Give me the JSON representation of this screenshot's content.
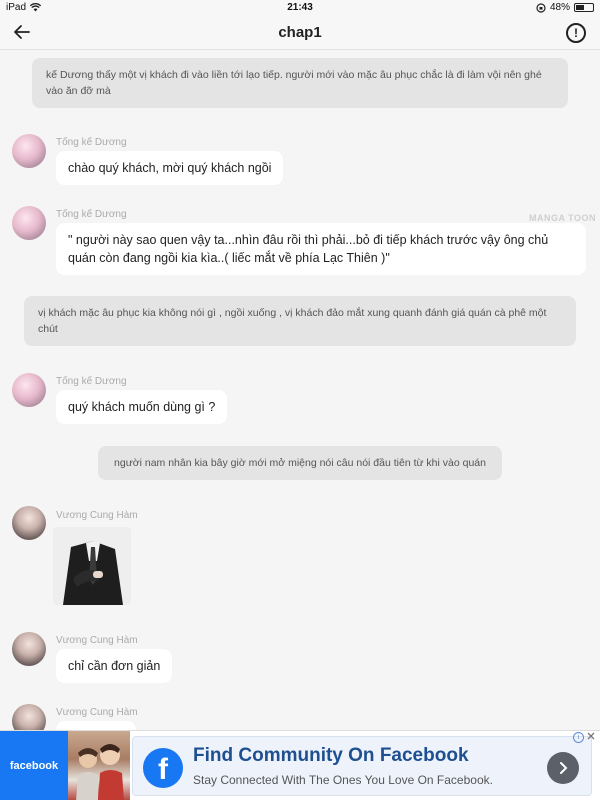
{
  "status_bar": {
    "device": "iPad",
    "wifi_icon": "wifi-icon",
    "time": "21:43",
    "battery_text": "48%",
    "battery_level": 0.48
  },
  "nav": {
    "back_icon": "arrow-left-icon",
    "title": "chap1",
    "info_icon": "info-circle-icon"
  },
  "messages": [
    {
      "type": "narration",
      "text": "kế Dương thấy một vị khách đi vào liền tới lạo tiếp. người mới vào mặc âu phục  chắc là đi làm vội nên ghé vào ăn đỡ mà"
    },
    {
      "type": "message",
      "sender": "Tống kế Dương",
      "text": "chào quý khách, mời quý khách ngồi"
    },
    {
      "type": "message",
      "sender": "Tống kế Dương",
      "text": "\" người này sao quen vậy ta...nhìn đâu rồi thì phải...bỏ đi tiếp khách trước vậy ông chủ quán còn đang ngồi kia kìa..( liếc mắt về phía Lạc Thiên  )\""
    },
    {
      "type": "narration",
      "text": "vị khách mặc âu phục kia không nói gì , ngồi xuống , vị khách đảo mắt xung quanh đánh giá quán cà phê một chút"
    },
    {
      "type": "message",
      "sender": "Tống kế Dương",
      "text": "quý khách muốn dùng gì ?"
    },
    {
      "type": "narration",
      "text": "người nam nhân kia bây giờ mới mở miệng nói câu nói đầu tiên từ khi vào quán"
    },
    {
      "type": "image",
      "sender": "Vương Cung Hàm"
    },
    {
      "type": "message",
      "sender": "Vương Cung Hàm",
      "text": "chỉ cần đơn giản"
    },
    {
      "type": "message",
      "sender": "Vương Cung Hàm",
      "text": ""
    }
  ],
  "watermark": "MANGA TOON",
  "ad": {
    "brand_tile": "facebook",
    "logo_letter": "f",
    "title": "Find Community On Facebook",
    "subtitle": "Stay Connected With The Ones You Love On Facebook.",
    "next_icon": "chevron-right-icon",
    "close_icon": "close-icon",
    "info_icon": "ad-info-icon"
  }
}
